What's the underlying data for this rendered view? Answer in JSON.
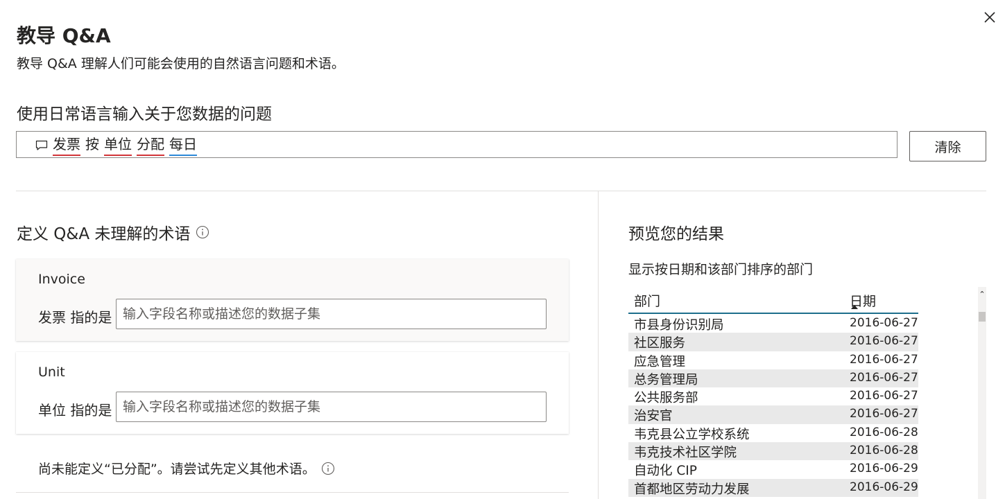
{
  "dialog": {
    "title": "教导 Q&A",
    "subtitle": "教导 Q&A 理解人们可能会使用的自然语言问题和术语。",
    "close_icon": "close-icon"
  },
  "question": {
    "label": "使用日常语言输入关于您数据的问题",
    "icon": "speech-bubble-icon",
    "tokens": [
      {
        "text": "发票",
        "underline": "red"
      },
      {
        "text": "按",
        "underline": "none"
      },
      {
        "text": "单位",
        "underline": "red"
      },
      {
        "text": "分配",
        "underline": "red"
      },
      {
        "text": "每日",
        "underline": "blue"
      }
    ],
    "clear_label": "清除"
  },
  "define": {
    "title": "定义 Q&A 未理解的术语",
    "info_icon": "info-icon",
    "cards": [
      {
        "term": "Invoice",
        "label": "发票 指的是",
        "placeholder": "输入字段名称或描述您的数据子集",
        "value": ""
      },
      {
        "term": "Unit",
        "label": "单位 指的是",
        "placeholder": "输入字段名称或描述您的数据子集",
        "value": ""
      }
    ],
    "note": "尚未能定义“已分配”。请尝试先定义其他术语。"
  },
  "preview": {
    "title": "预览您的结果",
    "caption": "显示按日期和该部门排序的部门",
    "columns": {
      "dept": "部门",
      "date": "日期"
    },
    "sort_indicator": "sort-ascending-icon",
    "rows": [
      {
        "dept": "市县身份识别局",
        "date": "2016-06-27"
      },
      {
        "dept": "社区服务",
        "date": "2016-06-27"
      },
      {
        "dept": "应急管理",
        "date": "2016-06-27"
      },
      {
        "dept": "总务管理局",
        "date": "2016-06-27"
      },
      {
        "dept": "公共服务部",
        "date": "2016-06-27"
      },
      {
        "dept": "治安官",
        "date": "2016-06-27"
      },
      {
        "dept": "韦克县公立学校系统",
        "date": "2016-06-28"
      },
      {
        "dept": "韦克技术社区学院",
        "date": "2016-06-28"
      },
      {
        "dept": "自动化 CIP",
        "date": "2016-06-29"
      },
      {
        "dept": "首都地区劳动力发展",
        "date": "2016-06-29"
      }
    ]
  },
  "colors": {
    "underline_red": "#d13438",
    "underline_blue": "#2b88d8",
    "header_line": "#1c6e8c",
    "alt_row": "#e9e9e9"
  }
}
